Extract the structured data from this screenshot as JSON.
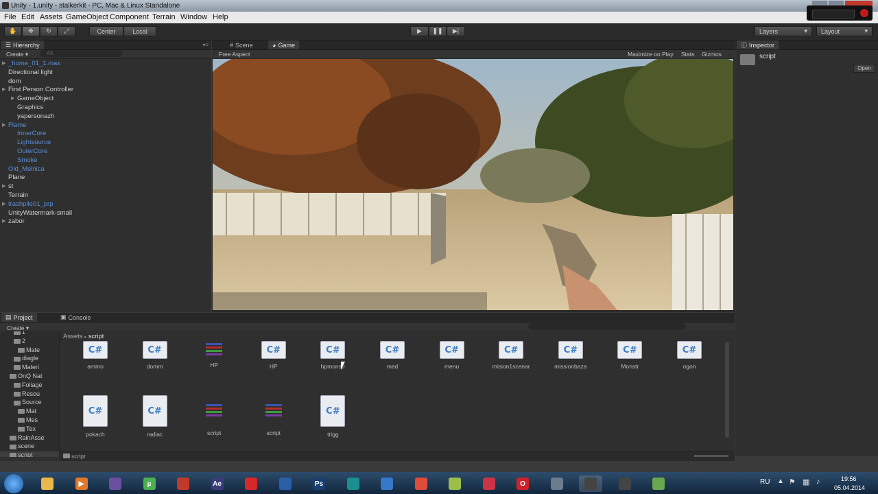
{
  "window": {
    "title": "Unity - 1.unity - stalkerkit - PC, Mac & Linux Standalone"
  },
  "menu": [
    "File",
    "Edit",
    "Assets",
    "GameObject",
    "Component",
    "Terrain",
    "Window",
    "Help"
  ],
  "toolbar": {
    "center_label": "Center",
    "local_label": "Local",
    "layers_label": "Layers",
    "layout_label": "Layout"
  },
  "hierarchy": {
    "tab": "Hierarchy",
    "create": "Create",
    "search_placeholder": "All",
    "items": [
      {
        "label": "_home_01_1.max",
        "color": "blue",
        "arrow": true,
        "indent": 0
      },
      {
        "label": "Directional light",
        "color": "white",
        "arrow": false,
        "indent": 0
      },
      {
        "label": "dom",
        "color": "white",
        "arrow": false,
        "indent": 0
      },
      {
        "label": "First Person Controller",
        "color": "white",
        "arrow": true,
        "indent": 0
      },
      {
        "label": "GameObject",
        "color": "white",
        "arrow": true,
        "indent": 1
      },
      {
        "label": "Graphics",
        "color": "white",
        "arrow": false,
        "indent": 1
      },
      {
        "label": "yapersonazh",
        "color": "white",
        "arrow": false,
        "indent": 1
      },
      {
        "label": "Flame",
        "color": "blue",
        "arrow": true,
        "indent": 0
      },
      {
        "label": "InnerCore",
        "color": "blue",
        "arrow": false,
        "indent": 1
      },
      {
        "label": "Lightsource",
        "color": "blue",
        "arrow": false,
        "indent": 1
      },
      {
        "label": "OuterCore",
        "color": "blue",
        "arrow": false,
        "indent": 1
      },
      {
        "label": "Smoke",
        "color": "blue",
        "arrow": false,
        "indent": 1
      },
      {
        "label": "Old_Melnica",
        "color": "blue",
        "arrow": false,
        "indent": 0
      },
      {
        "label": "Plane",
        "color": "white",
        "arrow": false,
        "indent": 0
      },
      {
        "label": "st",
        "color": "white",
        "arrow": true,
        "indent": 0
      },
      {
        "label": "Terrain",
        "color": "white",
        "arrow": false,
        "indent": 0
      },
      {
        "label": "trashpile01_prp",
        "color": "blue",
        "arrow": true,
        "indent": 0
      },
      {
        "label": "UnityWatermark-small",
        "color": "white",
        "arrow": false,
        "indent": 0
      },
      {
        "label": "zabor",
        "color": "white",
        "arrow": true,
        "indent": 0
      }
    ]
  },
  "scene_tabs": {
    "scene": "Scene",
    "game": "Game",
    "aspect": "Free Aspect",
    "maximize": "Maximize on Play",
    "stats": "Stats",
    "gizmos": "Gizmos"
  },
  "inspector": {
    "tab": "Inspector",
    "name": "script",
    "open": "Open"
  },
  "project": {
    "tab": "Project",
    "console_tab": "Console",
    "create": "Create",
    "breadcrumb_root": "Assets",
    "breadcrumb_current": "script",
    "footer_path": "script",
    "tree": [
      {
        "label": "1",
        "indent": 2
      },
      {
        "label": "2",
        "indent": 2
      },
      {
        "label": "Mate",
        "indent": 3
      },
      {
        "label": "diagle",
        "indent": 2
      },
      {
        "label": "Materi",
        "indent": 2
      },
      {
        "label": "OnQ Nat",
        "indent": 1
      },
      {
        "label": "Foliage",
        "indent": 2
      },
      {
        "label": "Resou",
        "indent": 2
      },
      {
        "label": "Source",
        "indent": 2
      },
      {
        "label": "Mat",
        "indent": 3
      },
      {
        "label": "Mes",
        "indent": 3
      },
      {
        "label": "Tex",
        "indent": 3
      },
      {
        "label": "RainAsse",
        "indent": 1
      },
      {
        "label": "scene",
        "indent": 1
      },
      {
        "label": "script",
        "indent": 1
      }
    ],
    "assets_row1": [
      {
        "label": "ammo",
        "kind": "cs"
      },
      {
        "label": "domm",
        "kind": "cs"
      },
      {
        "label": "HP",
        "kind": "rar"
      },
      {
        "label": "HP",
        "kind": "cs"
      },
      {
        "label": "hpmonstr",
        "kind": "cs"
      },
      {
        "label": "med",
        "kind": "cs"
      },
      {
        "label": "menu",
        "kind": "cs"
      },
      {
        "label": "mision1scenar",
        "kind": "cs"
      },
      {
        "label": "missionbaza",
        "kind": "cs"
      },
      {
        "label": "Monstr",
        "kind": "cs"
      },
      {
        "label": "ogon",
        "kind": "cs"
      }
    ],
    "assets_row2": [
      {
        "label": "pokach",
        "kind": "cs"
      },
      {
        "label": "radiac",
        "kind": "cs"
      },
      {
        "label": "script",
        "kind": "rar"
      },
      {
        "label": "script",
        "kind": "rar"
      },
      {
        "label": "trigg",
        "kind": "cs"
      }
    ],
    "cs_glyph": "C#"
  },
  "taskbar": {
    "lang": "RU",
    "time": "19:56",
    "date": "05.04.2014",
    "apps": [
      {
        "name": "explorer",
        "color": "#e8b84a",
        "glyph": ""
      },
      {
        "name": "media-player",
        "color": "#e07a28",
        "glyph": "▶"
      },
      {
        "name": "visual-studio",
        "color": "#6a4fa0",
        "glyph": ""
      },
      {
        "name": "utorrent",
        "color": "#4caf50",
        "glyph": "µ"
      },
      {
        "name": "app-red",
        "color": "#c0392b",
        "glyph": ""
      },
      {
        "name": "after-effects",
        "color": "#3b3b7a",
        "glyph": "Ae"
      },
      {
        "name": "record",
        "color": "#d62828",
        "glyph": ""
      },
      {
        "name": "app-blue",
        "color": "#2a5fa8",
        "glyph": ""
      },
      {
        "name": "photoshop",
        "color": "#1b3e70",
        "glyph": "Ps"
      },
      {
        "name": "app-teal",
        "color": "#1a8f8f",
        "glyph": ""
      },
      {
        "name": "outlook",
        "color": "#3678c9",
        "glyph": ""
      },
      {
        "name": "chrome",
        "color": "#dd4b39",
        "glyph": ""
      },
      {
        "name": "notes",
        "color": "#9bbf4a",
        "glyph": ""
      },
      {
        "name": "brush",
        "color": "#cc3344",
        "glyph": ""
      },
      {
        "name": "opera",
        "color": "#d0202a",
        "glyph": "O"
      },
      {
        "name": "app-gray",
        "color": "#6b7c8f",
        "glyph": ""
      },
      {
        "name": "unity",
        "color": "#444444",
        "glyph": ""
      },
      {
        "name": "unity-2",
        "color": "#444444",
        "glyph": ""
      },
      {
        "name": "app-green",
        "color": "#6aa84f",
        "glyph": ""
      }
    ]
  }
}
